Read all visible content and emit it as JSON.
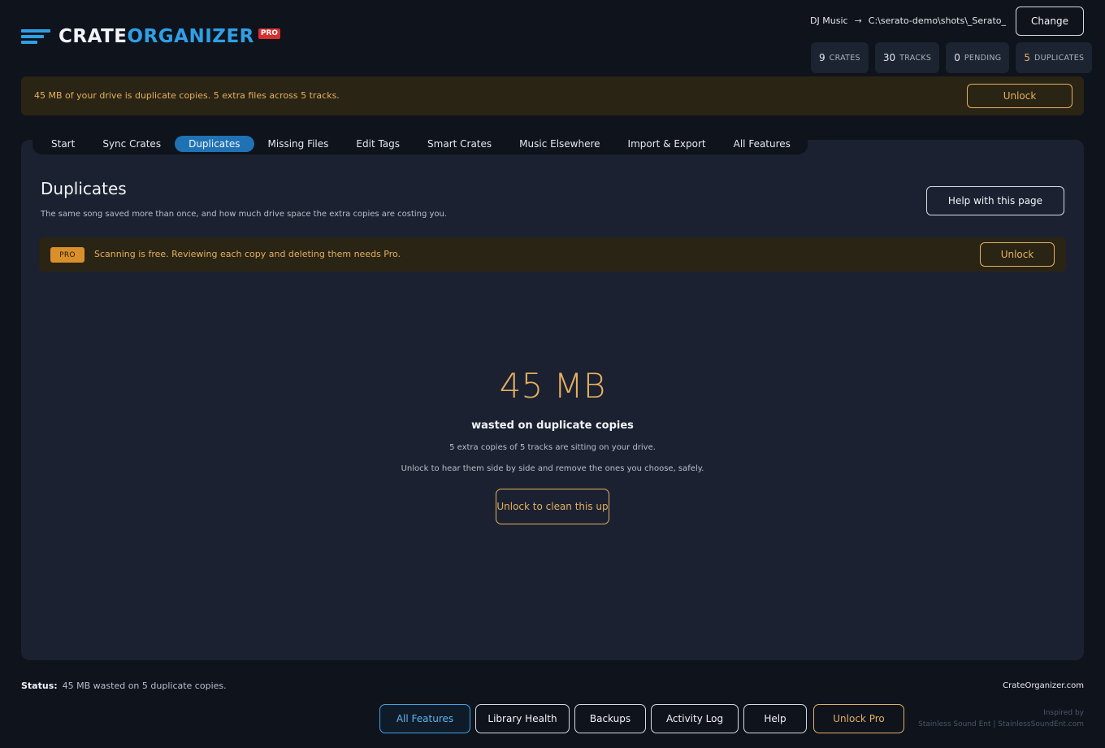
{
  "app": {
    "logo_part1": "CRATE",
    "logo_part2": "ORGANIZER",
    "logo_badge": "PRO"
  },
  "library": {
    "name": "DJ Music",
    "arrow": "→",
    "path": "C:\\serato-demo\\shots\\_Serato_",
    "change_label": "Change"
  },
  "stats": [
    {
      "value": "9",
      "label": "CRATES"
    },
    {
      "value": "30",
      "label": "TRACKS"
    },
    {
      "value": "0",
      "label": "PENDING"
    },
    {
      "value": "5",
      "label": "DUPLICATES"
    }
  ],
  "banner": {
    "text": "45 MB of your drive is duplicate copies. 5 extra files across 5 tracks.",
    "button": "Unlock"
  },
  "tabs": [
    {
      "label": "Start",
      "active": false
    },
    {
      "label": "Sync Crates",
      "active": false
    },
    {
      "label": "Duplicates",
      "active": true
    },
    {
      "label": "Missing Files",
      "active": false
    },
    {
      "label": "Edit Tags",
      "active": false
    },
    {
      "label": "Smart Crates",
      "active": false
    },
    {
      "label": "Music Elsewhere",
      "active": false
    },
    {
      "label": "Import & Export",
      "active": false
    },
    {
      "label": "All Features",
      "active": false
    }
  ],
  "page": {
    "title": "Duplicates",
    "subtitle": "The same song saved more than once, and how much drive space the extra copies are costing you.",
    "help_button": "Help with this page",
    "pro_badge": "PRO",
    "pro_text": "Scanning is free. Reviewing each copy and deleting them needs Pro.",
    "pro_button": "Unlock",
    "wasted_size": "45 MB",
    "wasted_caption": "wasted on duplicate copies",
    "line1": "5 extra copies of 5 tracks are sitting on your drive.",
    "line2": "Unlock to hear them side by side and remove the ones you choose, safely.",
    "clean_button": "Unlock to clean this up"
  },
  "footer": {
    "status_label": "Status:",
    "status_text": "45 MB wasted on 5 duplicate copies.",
    "site": "CrateOrganizer.com",
    "buttons": {
      "all_features": "All Features",
      "library_health": "Library Health",
      "backups": "Backups",
      "activity_log": "Activity Log",
      "help": "Help",
      "unlock_pro": "Unlock Pro"
    },
    "inspired_line1": "Inspired by",
    "inspired_line2": "Stainless Sound Ent | StainlessSoundEnt.com"
  },
  "colors": {
    "accent_blue": "#2f9fe6",
    "gold": "#e3b061",
    "pro_red": "#d62f2f"
  }
}
